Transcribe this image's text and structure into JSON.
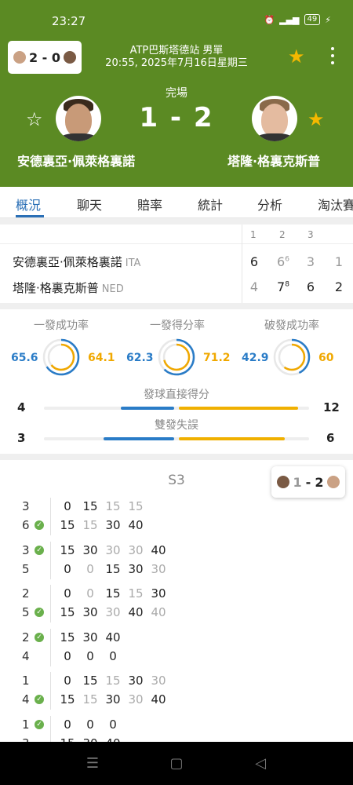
{
  "status_bar": {
    "time": "23:27",
    "battery": "49"
  },
  "header": {
    "h2h_score": "2 - 0",
    "tournament": "ATP巴斯塔德站 男單",
    "datetime": "20:55, 2025年7月16日星期三",
    "match_status": "完場",
    "score": "1 - 2",
    "player1": "安德裏亞·佩萊格裏諾",
    "player2": "塔隆·格裏克斯普",
    "player1_favorite": false,
    "player2_favorite": true,
    "match_favorite": true
  },
  "tabs": [
    "概況",
    "聊天",
    "賠率",
    "統計",
    "分析",
    "淘汰賽"
  ],
  "active_tab": "概況",
  "set_scores": {
    "headers": [
      "1",
      "2",
      "3"
    ],
    "players": [
      {
        "name": "安德裏亞·佩萊格裏諾",
        "country": "ITA",
        "sets": [
          "6",
          "6",
          "3"
        ],
        "tiebreak": [
          "",
          "6",
          ""
        ],
        "points": "1"
      },
      {
        "name": "塔隆·格裏克斯普",
        "country": "NED",
        "sets": [
          "4",
          "7",
          "6"
        ],
        "tiebreak": [
          "",
          "8",
          ""
        ],
        "points": "2"
      }
    ]
  },
  "stats": {
    "rings": [
      {
        "label": "一發成功率",
        "p1": "65.6",
        "p2": "64.1",
        "p1_value": 65.6,
        "p2_value": 64.1
      },
      {
        "label": "一發得分率",
        "p1": "62.3",
        "p2": "71.2",
        "p1_value": 62.3,
        "p2_value": 71.2
      },
      {
        "label": "破發成功率",
        "p1": "42.9",
        "p2": "60",
        "p1_value": 42.9,
        "p2_value": 60
      }
    ],
    "bars": [
      {
        "label": "發球直接得分",
        "p1": "4",
        "p2": "12",
        "p1_value": 4,
        "p2_value": 12
      },
      {
        "label": "雙發失誤",
        "p1": "3",
        "p2": "6",
        "p1_value": 3,
        "p2_value": 6
      }
    ],
    "colors": {
      "player1": "#2a7cc7",
      "player2": "#f0a800"
    }
  },
  "point_by_point": {
    "set_label": "S3",
    "set_score": {
      "p1": "1",
      "p2": "2"
    },
    "games": [
      {
        "top_score": "3",
        "bottom_score": "6",
        "server": "bottom",
        "top_points": [
          [
            "0",
            "d"
          ],
          [
            "15",
            "d"
          ],
          [
            "15",
            "l"
          ],
          [
            "15",
            "l"
          ]
        ],
        "bottom_points": [
          [
            "15",
            "d"
          ],
          [
            "15",
            "l"
          ],
          [
            "30",
            "d"
          ],
          [
            "40",
            "d"
          ]
        ]
      },
      {
        "top_score": "3",
        "bottom_score": "5",
        "server": "top",
        "top_points": [
          [
            "15",
            "d"
          ],
          [
            "30",
            "d"
          ],
          [
            "30",
            "l"
          ],
          [
            "30",
            "l"
          ],
          [
            "40",
            "d"
          ]
        ],
        "bottom_points": [
          [
            "0",
            "d"
          ],
          [
            "0",
            "l"
          ],
          [
            "15",
            "d"
          ],
          [
            "30",
            "d"
          ],
          [
            "30",
            "l"
          ]
        ]
      },
      {
        "top_score": "2",
        "bottom_score": "5",
        "server": "bottom",
        "top_points": [
          [
            "0",
            "d"
          ],
          [
            "0",
            "l"
          ],
          [
            "15",
            "d"
          ],
          [
            "15",
            "l"
          ],
          [
            "30",
            "d"
          ]
        ],
        "bottom_points": [
          [
            "15",
            "d"
          ],
          [
            "30",
            "d"
          ],
          [
            "30",
            "l"
          ],
          [
            "40",
            "d"
          ],
          [
            "40",
            "l"
          ]
        ]
      },
      {
        "top_score": "2",
        "bottom_score": "4",
        "server": "top",
        "top_points": [
          [
            "15",
            "d"
          ],
          [
            "30",
            "d"
          ],
          [
            "40",
            "d"
          ]
        ],
        "bottom_points": [
          [
            "0",
            "d"
          ],
          [
            "0",
            "d"
          ],
          [
            "0",
            "d"
          ]
        ]
      },
      {
        "top_score": "1",
        "bottom_score": "4",
        "server": "bottom",
        "top_points": [
          [
            "0",
            "d"
          ],
          [
            "15",
            "d"
          ],
          [
            "15",
            "l"
          ],
          [
            "30",
            "d"
          ],
          [
            "30",
            "l"
          ]
        ],
        "bottom_points": [
          [
            "15",
            "d"
          ],
          [
            "15",
            "l"
          ],
          [
            "30",
            "d"
          ],
          [
            "30",
            "l"
          ],
          [
            "40",
            "d"
          ]
        ]
      },
      {
        "top_score": "1",
        "bottom_score": "3",
        "server": "top",
        "top_points": [
          [
            "0",
            "d"
          ],
          [
            "0",
            "d"
          ],
          [
            "0",
            "d"
          ]
        ],
        "bottom_points": [
          [
            "15",
            "d"
          ],
          [
            "30",
            "d"
          ],
          [
            "40",
            "d"
          ]
        ]
      }
    ]
  }
}
